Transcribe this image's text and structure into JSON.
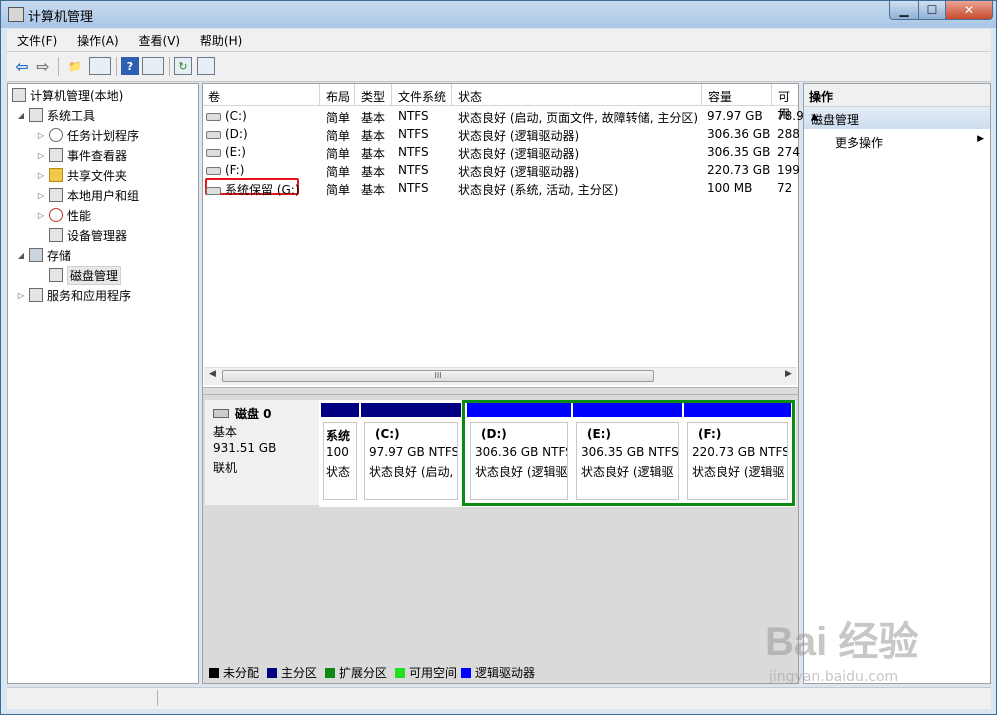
{
  "window": {
    "title": "计算机管理"
  },
  "menu": [
    "文件(F)",
    "操作(A)",
    "查看(V)",
    "帮助(H)"
  ],
  "tree": {
    "root": "计算机管理(本地)",
    "system_tools": "系统工具",
    "task_scheduler": "任务计划程序",
    "event_viewer": "事件查看器",
    "shared_folders": "共享文件夹",
    "local_users": "本地用户和组",
    "performance": "性能",
    "device_manager": "设备管理器",
    "storage": "存储",
    "disk_management": "磁盘管理",
    "services": "服务和应用程序"
  },
  "volume_list": {
    "columns": [
      "卷",
      "布局",
      "类型",
      "文件系统",
      "状态",
      "容量",
      "可用"
    ],
    "rows": [
      {
        "name": "(C:)",
        "layout": "简单",
        "type": "基本",
        "fs": "NTFS",
        "status": "状态良好 (启动, 页面文件, 故障转储, 主分区)",
        "capacity": "97.97 GB",
        "free": "78.9"
      },
      {
        "name": "(D:)",
        "layout": "简单",
        "type": "基本",
        "fs": "NTFS",
        "status": "状态良好 (逻辑驱动器)",
        "capacity": "306.36 GB",
        "free": "288"
      },
      {
        "name": "(E:)",
        "layout": "简单",
        "type": "基本",
        "fs": "NTFS",
        "status": "状态良好 (逻辑驱动器)",
        "capacity": "306.35 GB",
        "free": "274"
      },
      {
        "name": "(F:)",
        "layout": "简单",
        "type": "基本",
        "fs": "NTFS",
        "status": "状态良好 (逻辑驱动器)",
        "capacity": "220.73 GB",
        "free": "199"
      },
      {
        "name": "系统保留 (G:)",
        "layout": "简单",
        "type": "基本",
        "fs": "NTFS",
        "status": "状态良好 (系统, 活动, 主分区)",
        "capacity": "100 MB",
        "free": "72"
      }
    ],
    "scroll_thumb": "III"
  },
  "disk": {
    "name": "磁盘 0",
    "type": "基本",
    "size": "931.51 GB",
    "state": "联机",
    "partitions": [
      {
        "label": "系统",
        "line2": "100",
        "line3": "状态"
      },
      {
        "label": "(C:)",
        "line2": "97.97 GB NTFS",
        "line3": "状态良好 (启动,"
      },
      {
        "label": "(D:)",
        "line2": "306.36 GB NTFS",
        "line3": "状态良好 (逻辑驱"
      },
      {
        "label": "(E:)",
        "line2": "306.35 GB NTFS",
        "line3": "状态良好 (逻辑驱"
      },
      {
        "label": "(F:)",
        "line2": "220.73 GB NTFS",
        "line3": "状态良好 (逻辑驱"
      }
    ]
  },
  "legend": [
    {
      "label": "未分配",
      "color": "#000000"
    },
    {
      "label": "主分区",
      "color": "#000080"
    },
    {
      "label": "扩展分区",
      "color": "#0c8a12"
    },
    {
      "label": "可用空间",
      "color": "#22e122"
    },
    {
      "label": "逻辑驱动器",
      "color": "#0000ff"
    }
  ],
  "actions": {
    "header": "操作",
    "group": "磁盘管理",
    "more": "更多操作"
  },
  "watermark": {
    "brand": "Bai 经验",
    "url": "jingyan.baidu.com"
  },
  "colors": {
    "primary_partition": "#000080",
    "logical_drive": "#0000ff",
    "extended_partition": "#0c8a12",
    "highlight": "#e8161a"
  }
}
